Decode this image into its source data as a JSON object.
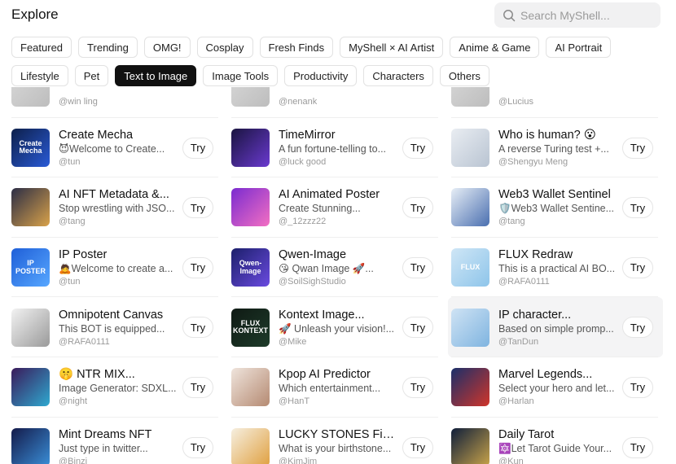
{
  "header": {
    "title": "Explore"
  },
  "search": {
    "placeholder": "Search MyShell..."
  },
  "categories_row1": [
    "Featured",
    "Trending",
    "OMG!",
    "Cosplay",
    "Fresh Finds",
    "MyShell × AI Artist",
    "Anime & Game",
    "AI Portrait"
  ],
  "categories_row2": [
    "Lifestyle",
    "Pet",
    "Text to Image",
    "Image Tools",
    "Productivity",
    "Characters",
    "Others"
  ],
  "active_category": "Text to Image",
  "try_label": "Try",
  "partial_authors": [
    "@win ling",
    "@nenank",
    "@Lucius"
  ],
  "bots": [
    {
      "name": "Create Mecha",
      "desc": "😈Welcome to Create...",
      "author": "@tun",
      "thumb_text": "Create Mecha",
      "thumb": [
        "#0d1f4a",
        "#2a5bd7"
      ]
    },
    {
      "name": "TimeMirror",
      "desc": "A fun fortune-telling to...",
      "author": "@luck good",
      "thumb_text": "",
      "thumb": [
        "#1a1440",
        "#6a3ad0"
      ]
    },
    {
      "name": "Who is human? 😮",
      "desc": "A reverse Turing test +...",
      "author": "@Shengyu Meng",
      "thumb_text": "",
      "thumb": [
        "#e9edf2",
        "#b9c4d2"
      ]
    },
    {
      "name": "AI NFT Metadata &...",
      "desc": "Stop wrestling with JSO...",
      "author": "@tang",
      "thumb_text": "",
      "thumb": [
        "#2b2d45",
        "#d9a24a"
      ]
    },
    {
      "name": "AI Animated Poster",
      "desc": "Create Stunning...",
      "author": "@_12zzz22",
      "thumb_text": "",
      "thumb": [
        "#7a2bd0",
        "#f36fc2"
      ]
    },
    {
      "name": "Web3 Wallet Sentinel",
      "desc": "🛡️Web3 Wallet Sentine...",
      "author": "@tang",
      "thumb_text": "",
      "thumb": [
        "#e7eef6",
        "#4a6fb0"
      ]
    },
    {
      "name": "IP Poster",
      "desc": "🙇Welcome to create a...",
      "author": "@tun",
      "thumb_text": "IP POSTER",
      "thumb": [
        "#1f5fd8",
        "#57a7ff"
      ]
    },
    {
      "name": "Qwen-Image",
      "desc": "😘 Qwan Image 🚀...",
      "author": "@SoilSighStudio",
      "thumb_text": "Qwen-Image",
      "thumb": [
        "#1c1f6b",
        "#6a4be0"
      ]
    },
    {
      "name": "FLUX Redraw",
      "desc": "This is a practical AI BO...",
      "author": "@RAFA0111",
      "thumb_text": "FLUX",
      "thumb": [
        "#cfe6f6",
        "#8ec5ea"
      ]
    },
    {
      "name": "Omnipotent Canvas",
      "desc": "This BOT is equipped...",
      "author": "@RAFA0111",
      "thumb_text": "",
      "thumb": [
        "#f2f2f2",
        "#9a9a9a"
      ]
    },
    {
      "name": "Kontext Image...",
      "desc": "🚀 Unleash your vision!...",
      "author": "@Mike",
      "thumb_text": "FLUX KONTEXT",
      "thumb": [
        "#0f1a14",
        "#1e3b2a"
      ]
    },
    {
      "name": "IP character...",
      "desc": "Based on simple promp...",
      "author": "@TanDun",
      "thumb_text": "",
      "thumb": [
        "#cfe3f4",
        "#7fb4e0"
      ]
    },
    {
      "name": "🤫 NTR MIX...",
      "desc": "Image Generator: SDXL...",
      "author": "@night",
      "thumb_text": "",
      "thumb": [
        "#3a1a5a",
        "#2fa9d0"
      ]
    },
    {
      "name": "Kpop AI Predictor",
      "desc": "Which entertainment...",
      "author": "@HanT",
      "thumb_text": "",
      "thumb": [
        "#efe4dc",
        "#b58a72"
      ]
    },
    {
      "name": "Marvel Legends...",
      "desc": "Select your hero and let...",
      "author": "@Harlan",
      "thumb_text": "",
      "thumb": [
        "#1a2f6a",
        "#d0352a"
      ]
    },
    {
      "name": "Mint Dreams NFT",
      "desc": "Just type in twitter...",
      "author": "@Binzi",
      "thumb_text": "",
      "thumb": [
        "#141a4a",
        "#3a8fd8"
      ]
    },
    {
      "name": "LUCKY STONES Finder",
      "desc": "What is your birthstone...",
      "author": "@KimJim",
      "thumb_text": "",
      "thumb": [
        "#f6efe0",
        "#e0a040"
      ]
    },
    {
      "name": "Daily Tarot",
      "desc": "🔯Let Tarot Guide Your...",
      "author": "@Kun",
      "thumb_text": "",
      "thumb": [
        "#0f1e3a",
        "#c9a44a"
      ]
    }
  ],
  "colors": {
    "active_chip": "#111111",
    "card_highlight": "#f4f4f5",
    "search_bg": "#f1f1f2"
  }
}
